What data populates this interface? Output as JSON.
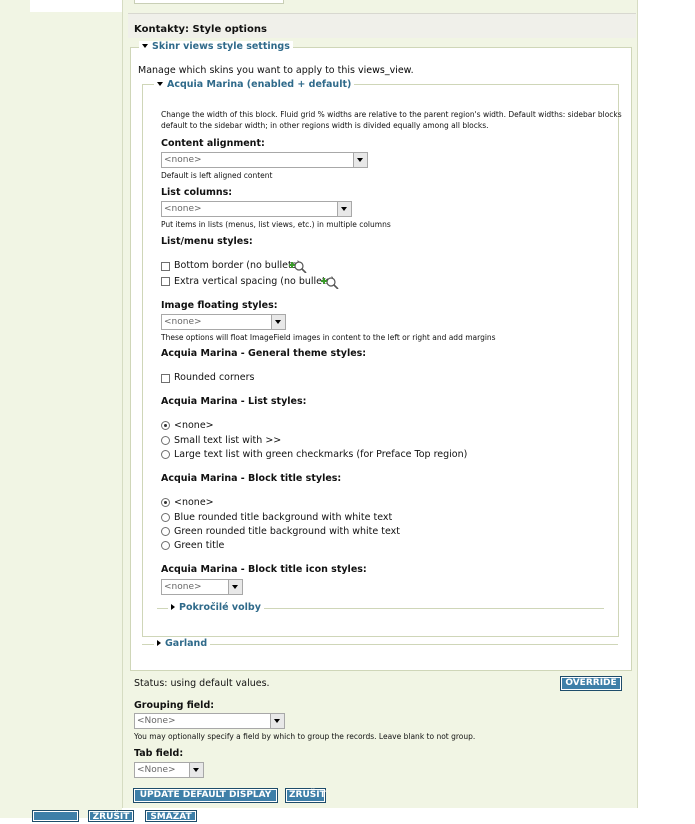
{
  "section_title": "Kontakty: Style options",
  "skinr": {
    "legend": "Skinr views style settings",
    "intro_prefix": "Manage which skins you want to apply to this ",
    "intro_code": "views_view",
    "intro_suffix": ".",
    "theme_legend": "Acquia Marina (enabled + default)",
    "width_desc_1": "Change the width of this block. Fluid grid % widths are relative to the parent region's width. Default widths: sidebar blocks",
    "width_desc_2": "default to the sidebar width; in other regions width is divided equally among all blocks.",
    "content_alignment": {
      "label": "Content alignment:",
      "value": "<none>",
      "desc": "Default is left aligned content"
    },
    "list_columns": {
      "label": "List columns:",
      "value": "<none>",
      "desc": "Put items in lists (menus, list views, etc.) in multiple columns"
    },
    "list_menu_styles": {
      "label": "List/menu styles:",
      "options": [
        "Bottom border (no bullets)",
        "Extra vertical spacing (no bullets)"
      ]
    },
    "image_floating": {
      "label": "Image floating styles:",
      "value": "<none>",
      "desc": "These options will float ImageField images in content to the left or right and add margins"
    },
    "general_theme": {
      "label": "Acquia Marina - General theme styles:",
      "options": [
        "Rounded corners"
      ]
    },
    "list_styles": {
      "label": "Acquia Marina - List styles:",
      "options": [
        "<none>",
        "Small text list with >>",
        "Large text list with green checkmarks (for Preface Top region)"
      ],
      "selected": 0
    },
    "block_title_styles": {
      "label": "Acquia Marina - Block title styles:",
      "options": [
        "<none>",
        "Blue rounded title background with white text",
        "Green rounded title background with white text",
        "Green title"
      ],
      "selected": 0
    },
    "block_title_icon": {
      "label": "Acquia Marina - Block title icon styles:",
      "value": "<none>"
    },
    "advanced_legend": "Pokročilé volby",
    "garland_legend": "Garland"
  },
  "status": {
    "text": "Status: using default values.",
    "override_label": "OVERRIDE"
  },
  "grouping": {
    "label": "Grouping field:",
    "value": "<None>",
    "desc": "You may optionally specify a field by which to group the records. Leave blank to not group."
  },
  "tab_field": {
    "label": "Tab field:",
    "value": "<None>"
  },
  "buttons": {
    "update": "UPDATE DEFAULT DISPLAY",
    "cancel": "ZRUŠIT"
  },
  "bottom_buttons": {
    "first": "",
    "cancel": "ZRUŠIT",
    "delete": "SMAZAT"
  },
  "colors": {
    "accent": "#3e7fa8",
    "legend": "#2f6a8a",
    "panel_bg": "#f1f5e4"
  }
}
